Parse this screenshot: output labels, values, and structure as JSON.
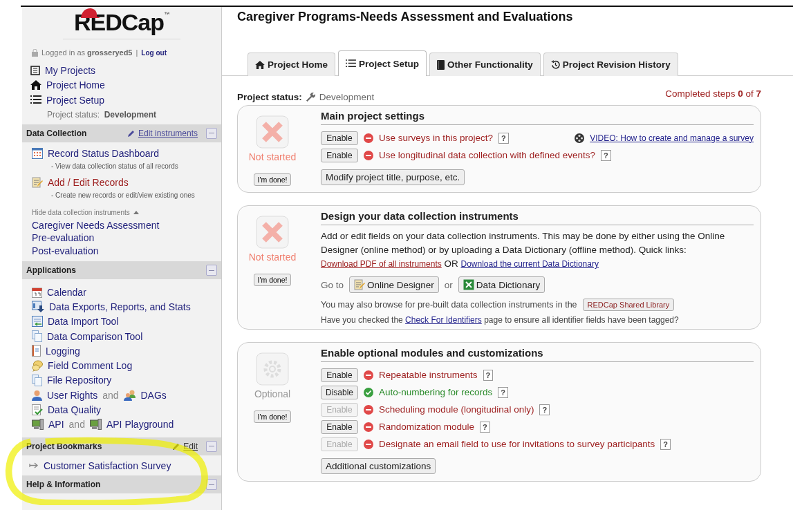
{
  "sidebar": {
    "logo": {
      "text": "REDCap",
      "tm": "™"
    },
    "login": {
      "prefix": "Logged in as",
      "user": "grosseryed5",
      "separator": "|",
      "logout": "Log out"
    },
    "nav": [
      {
        "label": "My Projects"
      },
      {
        "label": "Project Home"
      },
      {
        "label": "Project Setup"
      }
    ],
    "project_status": {
      "label": "Project status:",
      "value": "Development"
    },
    "data_collection": {
      "title": "Data Collection",
      "edit": "Edit instruments",
      "items": [
        {
          "label": "Record Status Dashboard",
          "description": "- View data collection status of all records",
          "color": "#1e1e7a"
        },
        {
          "label": "Add / Edit Records",
          "description": "- Create new records or edit/view existing ones",
          "color": "#9c1c1c"
        }
      ],
      "toggle": "Hide data collection instruments",
      "expanded": true,
      "instruments": [
        "Caregiver Needs Assessment",
        "Pre-evaluation",
        "Post-evaluation"
      ]
    },
    "applications": {
      "title": "Applications",
      "items": [
        {
          "label": "Calendar"
        },
        {
          "label": "Data Exports, Reports, and Stats"
        },
        {
          "label": "Data Import Tool"
        },
        {
          "label": "Data Comparison Tool"
        },
        {
          "label": "Logging"
        },
        {
          "label": "Field Comment Log"
        },
        {
          "label": "File Repository"
        },
        {
          "label": "User Rights",
          "joiner": "and",
          "label2": "DAGs"
        },
        {
          "label": "Data Quality"
        },
        {
          "label": "API",
          "joiner": "and",
          "label2": "API Playground"
        }
      ]
    },
    "bookmarks": {
      "title": "Project Bookmarks",
      "edit": "Edit",
      "items": [
        "Customer Satisfaction Survey"
      ]
    },
    "help": {
      "title": "Help & Information"
    }
  },
  "main": {
    "title": "Caregiver Programs-Needs Assessment and Evaluations",
    "tabs": [
      {
        "label": "Project Home",
        "selected": false
      },
      {
        "label": "Project Setup",
        "selected": true
      },
      {
        "label": "Other Functionality",
        "selected": false
      },
      {
        "label": "Project Revision History",
        "selected": false
      }
    ],
    "status": {
      "label": "Project status:",
      "value": "Development"
    },
    "completed": "Completed steps **0** of **7**",
    "steps": [
      {
        "kind": "not_started",
        "status_text": "Not started",
        "done": "I'm done!",
        "title": "Main project settings",
        "toggles": [
          {
            "button": "Enable",
            "button_disabled": false,
            "on": false,
            "label": "Use surveys in this project?",
            "help": "?",
            "video": "VIDEO: How to create and manage a survey"
          },
          {
            "button": "Enable",
            "button_disabled": false,
            "on": false,
            "label": "Use longitudinal data collection with defined events?",
            "help": "?"
          }
        ],
        "action": "Modify project title, purpose, etc."
      },
      {
        "kind": "not_started",
        "status_text": "Not started",
        "done": "I'm done!",
        "title": "Design your data collection instruments",
        "intro": "Add or edit fields on your data collection instruments. This may be done by either using the Online Designer (online method) or by uploading a Data Dictionary (offline method). Quick links:",
        "link_pdf": "Download PDF of all instruments",
        "or_text": "OR",
        "link_dictionary": "Download the current Data Dictionary",
        "goto": "Go to",
        "designer_button": "Online Designer",
        "or2": "or",
        "dictionary_button": "Data Dictionary",
        "library_text": "You may also browse for pre-built data collection instruments in the",
        "library_button": "REDCap Shared Library",
        "identifiers_before": "Have you checked the",
        "identifiers_link": "Check For Identifiers",
        "identifiers_after": "page to ensure all identifier fields have been tagged?"
      },
      {
        "kind": "optional",
        "status_text": "Optional",
        "done": "I'm done!",
        "title": "Enable optional modules and customizations",
        "toggles": [
          {
            "button": "Enable",
            "button_disabled": false,
            "on": false,
            "label": "Repeatable instruments",
            "help": "?"
          },
          {
            "button": "Disable",
            "button_disabled": false,
            "on": true,
            "label": "Auto-numbering for records",
            "help": "?"
          },
          {
            "button": "Enable",
            "button_disabled": true,
            "on": false,
            "label": "Scheduling module (longitudinal only)",
            "help": "?"
          },
          {
            "button": "Enable",
            "button_disabled": false,
            "on": false,
            "label": "Randomization module",
            "help": "?"
          },
          {
            "button": "Enable",
            "button_disabled": true,
            "on": false,
            "label": "Designate an email field to use for invitations to survey participants",
            "help": "?"
          }
        ],
        "action": "Additional customizations"
      }
    ]
  }
}
